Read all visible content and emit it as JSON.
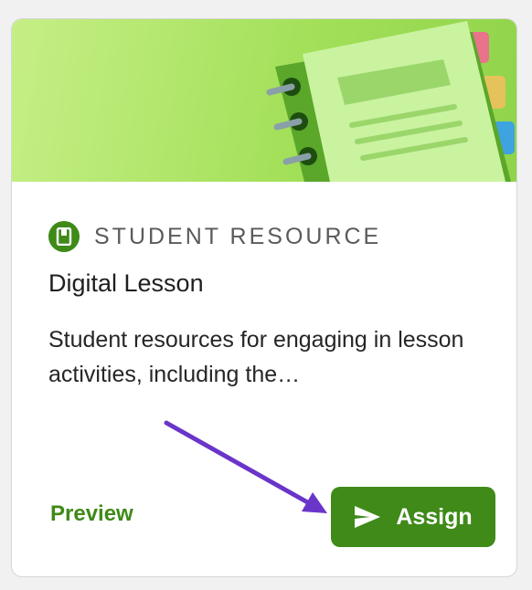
{
  "card": {
    "resource_type": "STUDENT RESOURCE",
    "type_icon": "book-icon",
    "title": "Digital Lesson",
    "description": "Student resources for engaging in lesson activities, including the…",
    "preview_label": "Preview",
    "assign_label": "Assign",
    "assign_icon": "send-icon",
    "banner_icon": "notebook-illustration"
  },
  "colors": {
    "accent_green": "#3f8a18",
    "banner_green": "#a4e05a",
    "annotation_arrow": "#6a35c9"
  }
}
